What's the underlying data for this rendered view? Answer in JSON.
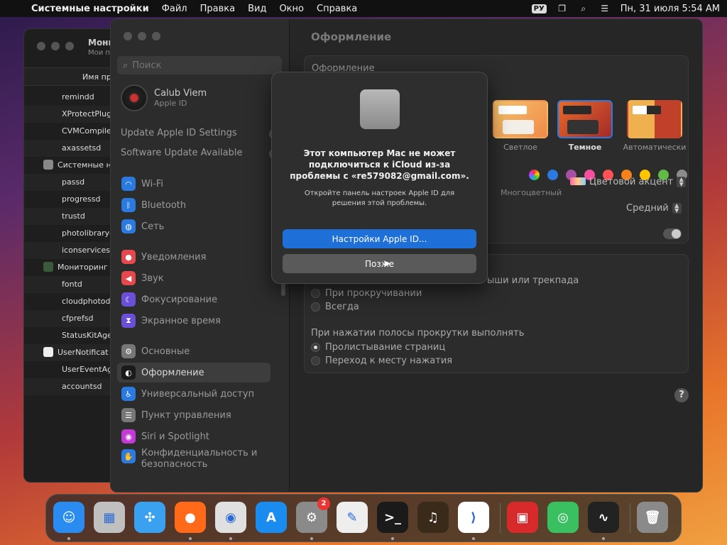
{
  "menubar": {
    "app": "Системные настройки",
    "items": [
      "Файл",
      "Правка",
      "Вид",
      "Окно",
      "Справка"
    ],
    "input_source": "РУ",
    "datetime": "Пн, 31 июля  5:54 AM"
  },
  "bg_window": {
    "title": "Мони",
    "subtitle": "Мои п",
    "column": "Имя пр",
    "rows": [
      "remindd",
      "XProtectPlug",
      "CVMCompile",
      "axassetsd",
      "Системные н",
      "passd",
      "progressd",
      "trustd",
      "photolibraryd",
      "iconservicesa",
      "Мониторинг",
      "fontd",
      "cloudphotod",
      "cfprefsd",
      "StatusKitAge",
      "UserNotificat",
      "UserEventAg",
      "accountsd"
    ]
  },
  "sidebar": {
    "search_placeholder": "Поиск",
    "account_name": "Calub Viem",
    "account_sub": "Apple ID",
    "notices": [
      {
        "label": "Update Apple ID Settings",
        "count": "1"
      },
      {
        "label": "Software Update Available",
        "count": "1"
      }
    ],
    "items": [
      {
        "label": "Wi-Fi",
        "icon": "wifi-icon",
        "color": "#2a7ae2"
      },
      {
        "label": "Bluetooth",
        "icon": "bluetooth-icon",
        "color": "#2a7ae2"
      },
      {
        "label": "Сеть",
        "icon": "globe-icon",
        "color": "#2a7ae2"
      },
      {
        "label": "Уведомления",
        "icon": "bell-icon",
        "color": "#e5484d"
      },
      {
        "label": "Звук",
        "icon": "speaker-icon",
        "color": "#e5484d"
      },
      {
        "label": "Фокусирование",
        "icon": "moon-icon",
        "color": "#6b4fd8"
      },
      {
        "label": "Экранное время",
        "icon": "hourglass-icon",
        "color": "#6b4fd8"
      },
      {
        "label": "Основные",
        "icon": "gear-icon",
        "color": "#777777"
      },
      {
        "label": "Оформление",
        "icon": "appearance-icon",
        "color": "#1a1a1a"
      },
      {
        "label": "Универсальный доступ",
        "icon": "accessibility-icon",
        "color": "#2a7ae2"
      },
      {
        "label": "Пункт управления",
        "icon": "control-center-icon",
        "color": "#777777"
      },
      {
        "label": "Siri и Spotlight",
        "icon": "siri-icon",
        "color": "#c43ad6"
      },
      {
        "label": "Конфиденциальность и безопасность",
        "icon": "hand-icon",
        "color": "#2a7ae2"
      }
    ]
  },
  "content": {
    "title": "Оформление",
    "appearance_label": "Оформление",
    "themes": [
      "Светлое",
      "Темное",
      "Автоматически"
    ],
    "multicolor_label": "Многоцветный",
    "accent_colors": [
      "#2a7ae2",
      "#a550a7",
      "#f74f9e",
      "#ff5257",
      "#f7821b",
      "#ffc600",
      "#62ba46",
      "#8c8c8c"
    ],
    "accent_select": "Цветовой акцент",
    "size_select": "Средний",
    "scroll_partial": "ыши или трекпада",
    "scroll_options": [
      "При прокручивании",
      "Всегда"
    ],
    "click_label": "При нажатии полосы прокрутки выполнять",
    "click_options": [
      "Пролистывание страниц",
      "Переход к месту нажатия"
    ],
    "help": "?"
  },
  "dialog": {
    "heading": "Этот компьютер Mac не может подключиться к iCloud из-за проблемы с «re579082@gmail.com».",
    "body": "Откройте панель настроек Apple ID для решения этой проблемы.",
    "primary": "Настройки Apple ID...",
    "secondary": "Позже"
  },
  "dock": {
    "apps": [
      {
        "name": "finder-icon",
        "color": "#2a8cf0",
        "glyph": "☺"
      },
      {
        "name": "launchpad-icon",
        "color": "#c0c0c0",
        "glyph": "▦"
      },
      {
        "name": "safari-icon",
        "color": "#3aa0f0",
        "glyph": "✣"
      },
      {
        "name": "firefox-icon",
        "color": "#ff6a1a",
        "glyph": "●"
      },
      {
        "name": "chrome-icon",
        "color": "#e0e0e0",
        "glyph": "◉"
      },
      {
        "name": "app-store-icon",
        "color": "#1a8cf0",
        "glyph": "A"
      },
      {
        "name": "system-settings-icon",
        "color": "#8a8a8a",
        "glyph": "⚙",
        "badge": "2"
      },
      {
        "name": "textedit-icon",
        "color": "#eeeeee",
        "glyph": "✎"
      },
      {
        "name": "terminal-icon",
        "color": "#1a1a1a",
        "glyph": ">_"
      },
      {
        "name": "garageband-icon",
        "color": "#3a2a1a",
        "glyph": "♫"
      },
      {
        "name": "vscode-icon",
        "color": "#ffffff",
        "glyph": "⟩"
      },
      {
        "name": "photo-booth-icon",
        "color": "#d82a2a",
        "glyph": "▣"
      },
      {
        "name": "find-my-icon",
        "color": "#3ac060",
        "glyph": "◎"
      },
      {
        "name": "activity-monitor-icon",
        "color": "#222222",
        "glyph": "∿"
      },
      {
        "name": "trash-icon",
        "color": "#8a8a8a",
        "glyph": "🗑"
      }
    ]
  }
}
